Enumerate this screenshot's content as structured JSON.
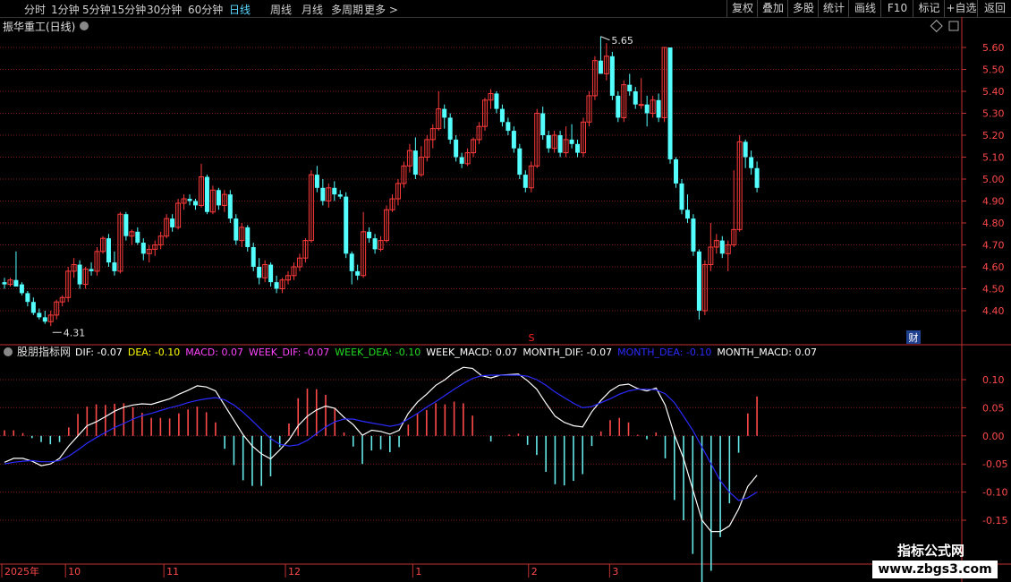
{
  "toolbar": {
    "periods": [
      "分时",
      "1分钟",
      "5分钟",
      "15分钟",
      "30分钟",
      "60分钟",
      "日线",
      "周线",
      "月线",
      "多周期",
      "更多 >"
    ],
    "active_period": "日线",
    "right_buttons": [
      "复权",
      "叠加",
      "多股",
      "统计",
      "画线",
      "F10",
      "标记",
      "+自选",
      "返回"
    ]
  },
  "main_panel": {
    "title": "振华重工(日线)",
    "high_label": "5.65",
    "low_label": "4.31",
    "s_marker": "S",
    "cai_badge": "财"
  },
  "indicator_panel": {
    "name": "股朋指标网",
    "legend": [
      {
        "text": "DIF: -0.07",
        "color": "#ffffff"
      },
      {
        "text": "DEA: -0.10",
        "color": "#ffff00"
      },
      {
        "text": "MACD: 0.07",
        "color": "#ff44ff"
      },
      {
        "text": "WEEK_DIF: -0.07",
        "color": "#ff44ff"
      },
      {
        "text": "WEEK_DEA: -0.10",
        "color": "#22dd22"
      },
      {
        "text": "WEEK_MACD: 0.07",
        "color": "#ffffff"
      },
      {
        "text": "MONTH_DIF: -0.07",
        "color": "#ffffff"
      },
      {
        "text": "MONTH_DEA: -0.10",
        "color": "#2b2bff"
      },
      {
        "text": "MONTH_MACD: 0.07",
        "color": "#ffffff"
      }
    ]
  },
  "x_axis": {
    "labels": [
      {
        "text": "2025年",
        "idx": 0
      },
      {
        "text": "10",
        "idx": 11
      },
      {
        "text": "11",
        "idx": 28
      },
      {
        "text": "12",
        "idx": 49
      },
      {
        "text": "1",
        "idx": 71
      },
      {
        "text": "2",
        "idx": 91
      },
      {
        "text": "3",
        "idx": 105
      }
    ]
  },
  "watermark": {
    "line1": "指标公式网",
    "line2": "www.zbgs3.com"
  },
  "colors": {
    "up": "#ff3b3b",
    "down": "#54ffff",
    "grid": "#7a1a1a",
    "axis": "#c03030",
    "dif": "#ffffff",
    "dea": "#2b2bff"
  },
  "chart_data": [
    {
      "type": "candlestick",
      "title": "振华重工(日线)",
      "ylim": [
        4.31,
        5.65
      ],
      "y_ticks": [
        4.4,
        4.5,
        4.6,
        4.7,
        4.8,
        4.9,
        5.0,
        5.1,
        5.2,
        5.3,
        5.4,
        5.5,
        5.6
      ],
      "ohlc": [
        [
          4.53,
          4.55,
          4.5,
          4.52
        ],
        [
          4.52,
          4.55,
          4.51,
          4.54
        ],
        [
          4.54,
          4.67,
          4.52,
          4.51
        ],
        [
          4.52,
          4.53,
          4.47,
          4.48
        ],
        [
          4.48,
          4.49,
          4.42,
          4.44
        ],
        [
          4.44,
          4.46,
          4.38,
          4.39
        ],
        [
          4.39,
          4.41,
          4.36,
          4.37
        ],
        [
          4.37,
          4.4,
          4.34,
          4.35
        ],
        [
          4.35,
          4.4,
          4.33,
          4.38
        ],
        [
          4.38,
          4.45,
          4.36,
          4.44
        ],
        [
          4.44,
          4.47,
          4.42,
          4.46
        ],
        [
          4.46,
          4.6,
          4.44,
          4.58
        ],
        [
          4.58,
          4.64,
          4.55,
          4.61
        ],
        [
          4.61,
          4.63,
          4.5,
          4.52
        ],
        [
          4.52,
          4.6,
          4.5,
          4.59
        ],
        [
          4.59,
          4.62,
          4.56,
          4.58
        ],
        [
          4.58,
          4.69,
          4.56,
          4.67
        ],
        [
          4.67,
          4.74,
          4.66,
          4.73
        ],
        [
          4.73,
          4.75,
          4.6,
          4.62
        ],
        [
          4.62,
          4.67,
          4.56,
          4.58
        ],
        [
          4.58,
          4.85,
          4.57,
          4.84
        ],
        [
          4.84,
          4.85,
          4.72,
          4.74
        ],
        [
          4.74,
          4.77,
          4.7,
          4.76
        ],
        [
          4.76,
          4.78,
          4.7,
          4.71
        ],
        [
          4.71,
          4.73,
          4.63,
          4.66
        ],
        [
          4.66,
          4.7,
          4.62,
          4.68
        ],
        [
          4.68,
          4.72,
          4.65,
          4.7
        ],
        [
          4.7,
          4.76,
          4.68,
          4.74
        ],
        [
          4.74,
          4.84,
          4.73,
          4.82
        ],
        [
          4.82,
          4.84,
          4.76,
          4.78
        ],
        [
          4.78,
          4.91,
          4.77,
          4.89
        ],
        [
          4.89,
          4.93,
          4.86,
          4.91
        ],
        [
          4.91,
          4.93,
          4.88,
          4.9
        ],
        [
          4.9,
          4.91,
          4.86,
          4.88
        ],
        [
          4.88,
          5.07,
          4.87,
          5.01
        ],
        [
          5.01,
          5.02,
          4.84,
          4.85
        ],
        [
          4.85,
          4.97,
          4.84,
          4.95
        ],
        [
          4.95,
          4.96,
          4.86,
          4.88
        ],
        [
          4.88,
          4.95,
          4.85,
          4.93
        ],
        [
          4.93,
          4.95,
          4.8,
          4.82
        ],
        [
          4.82,
          4.84,
          4.7,
          4.72
        ],
        [
          4.72,
          4.8,
          4.69,
          4.78
        ],
        [
          4.78,
          4.79,
          4.67,
          4.69
        ],
        [
          4.69,
          4.71,
          4.58,
          4.6
        ],
        [
          4.6,
          4.64,
          4.52,
          4.55
        ],
        [
          4.55,
          4.63,
          4.53,
          4.61
        ],
        [
          4.61,
          4.62,
          4.51,
          4.53
        ],
        [
          4.53,
          4.56,
          4.48,
          4.5
        ],
        [
          4.5,
          4.55,
          4.48,
          4.54
        ],
        [
          4.54,
          4.58,
          4.52,
          4.56
        ],
        [
          4.56,
          4.62,
          4.54,
          4.6
        ],
        [
          4.6,
          4.66,
          4.58,
          4.64
        ],
        [
          4.64,
          4.73,
          4.62,
          4.72
        ],
        [
          4.72,
          5.04,
          4.71,
          5.02
        ],
        [
          5.02,
          5.06,
          4.94,
          4.96
        ],
        [
          4.96,
          5.0,
          4.88,
          4.9
        ],
        [
          4.9,
          4.98,
          4.87,
          4.96
        ],
        [
          4.96,
          4.99,
          4.9,
          4.93
        ],
        [
          4.93,
          4.95,
          4.91,
          4.92
        ],
        [
          4.92,
          4.94,
          4.64,
          4.66
        ],
        [
          4.66,
          4.67,
          4.52,
          4.58
        ],
        [
          4.58,
          4.61,
          4.54,
          4.56
        ],
        [
          4.56,
          4.85,
          4.55,
          4.76
        ],
        [
          4.76,
          4.78,
          4.71,
          4.73
        ],
        [
          4.73,
          4.75,
          4.66,
          4.68
        ],
        [
          4.68,
          4.74,
          4.67,
          4.72
        ],
        [
          4.72,
          4.88,
          4.71,
          4.86
        ],
        [
          4.86,
          4.93,
          4.85,
          4.91
        ],
        [
          4.91,
          5.0,
          4.88,
          4.98
        ],
        [
          4.98,
          5.08,
          4.96,
          5.06
        ],
        [
          5.06,
          5.16,
          5.03,
          5.13
        ],
        [
          5.13,
          5.19,
          5.0,
          5.02
        ],
        [
          5.02,
          5.15,
          5.01,
          5.1
        ],
        [
          5.1,
          5.2,
          5.08,
          5.18
        ],
        [
          5.18,
          5.25,
          5.14,
          5.23
        ],
        [
          5.23,
          5.4,
          5.22,
          5.32
        ],
        [
          5.32,
          5.34,
          5.23,
          5.28
        ],
        [
          5.28,
          5.3,
          5.16,
          5.18
        ],
        [
          5.18,
          5.2,
          5.08,
          5.1
        ],
        [
          5.1,
          5.12,
          5.05,
          5.07
        ],
        [
          5.07,
          5.14,
          5.06,
          5.12
        ],
        [
          5.12,
          5.19,
          5.1,
          5.18
        ],
        [
          5.18,
          5.26,
          5.16,
          5.24
        ],
        [
          5.24,
          5.37,
          5.22,
          5.36
        ],
        [
          5.36,
          5.41,
          5.32,
          5.39
        ],
        [
          5.39,
          5.4,
          5.3,
          5.32
        ],
        [
          5.32,
          5.34,
          5.24,
          5.26
        ],
        [
          5.26,
          5.28,
          5.2,
          5.22
        ],
        [
          5.22,
          5.24,
          5.12,
          5.14
        ],
        [
          5.14,
          5.16,
          5.0,
          5.02
        ],
        [
          5.02,
          5.04,
          4.94,
          4.96
        ],
        [
          4.96,
          5.08,
          4.94,
          5.06
        ],
        [
          5.06,
          5.32,
          5.05,
          5.3
        ],
        [
          5.3,
          5.33,
          5.18,
          5.2
        ],
        [
          5.2,
          5.22,
          5.12,
          5.14
        ],
        [
          5.14,
          5.22,
          5.12,
          5.2
        ],
        [
          5.2,
          5.22,
          5.1,
          5.12
        ],
        [
          5.12,
          5.24,
          5.1,
          5.18
        ],
        [
          5.18,
          5.25,
          5.14,
          5.16
        ],
        [
          5.16,
          5.18,
          5.1,
          5.12
        ],
        [
          5.12,
          5.28,
          5.1,
          5.26
        ],
        [
          5.26,
          5.4,
          5.24,
          5.38
        ],
        [
          5.38,
          5.56,
          5.36,
          5.54
        ],
        [
          5.54,
          5.65,
          5.5,
          5.48
        ],
        [
          5.48,
          5.62,
          5.45,
          5.56
        ],
        [
          5.56,
          5.58,
          5.36,
          5.38
        ],
        [
          5.38,
          5.4,
          5.26,
          5.28
        ],
        [
          5.28,
          5.45,
          5.26,
          5.43
        ],
        [
          5.43,
          5.48,
          5.38,
          5.4
        ],
        [
          5.4,
          5.42,
          5.32,
          5.34
        ],
        [
          5.34,
          5.46,
          5.32,
          5.34
        ],
        [
          5.34,
          5.38,
          5.24,
          5.3
        ],
        [
          5.3,
          5.38,
          5.28,
          5.36
        ],
        [
          5.36,
          5.39,
          5.26,
          5.28
        ],
        [
          5.28,
          5.6,
          5.26,
          5.6
        ],
        [
          5.6,
          5.6,
          5.07,
          5.09
        ],
        [
          5.09,
          5.1,
          4.96,
          4.98
        ],
        [
          4.98,
          5.0,
          4.84,
          4.86
        ],
        [
          4.86,
          4.93,
          4.8,
          4.82
        ],
        [
          4.82,
          4.84,
          4.65,
          4.67
        ],
        [
          4.67,
          4.68,
          4.36,
          4.4
        ],
        [
          4.4,
          4.63,
          4.38,
          4.61
        ],
        [
          4.61,
          4.8,
          4.58,
          4.69
        ],
        [
          4.69,
          4.75,
          4.66,
          4.72
        ],
        [
          4.72,
          4.74,
          4.64,
          4.66
        ],
        [
          4.66,
          4.72,
          4.58,
          4.7
        ],
        [
          4.7,
          5.04,
          4.69,
          4.77
        ],
        [
          4.77,
          5.2,
          4.76,
          5.17
        ],
        [
          5.17,
          5.18,
          5.05,
          5.1
        ],
        [
          5.1,
          5.13,
          5.02,
          5.05
        ],
        [
          5.05,
          5.08,
          4.94,
          4.96
        ]
      ]
    },
    {
      "type": "line+bar",
      "title": "股朋指标网",
      "ylim": [
        -0.18,
        0.15
      ],
      "y_ticks": [
        0.1,
        0.05,
        0.0,
        -0.05,
        -0.1,
        -0.15
      ],
      "series": [
        {
          "name": "DIF",
          "values": [
            -0.047,
            -0.04,
            -0.04,
            -0.045,
            -0.053,
            -0.05,
            -0.04,
            -0.018,
            0.0,
            0.018,
            0.025,
            0.034,
            0.044,
            0.051,
            0.055,
            0.057,
            0.056,
            0.061,
            0.066,
            0.074,
            0.081,
            0.089,
            0.087,
            0.08,
            0.054,
            0.028,
            0.002,
            -0.018,
            -0.032,
            -0.041,
            -0.025,
            -0.007,
            0.018,
            0.035,
            0.046,
            0.053,
            0.049,
            0.033,
            0.02,
            0.001,
            0.01,
            0.008,
            0.003,
            0.01,
            0.04,
            0.06,
            0.074,
            0.09,
            0.1,
            0.113,
            0.122,
            0.12,
            0.107,
            0.103,
            0.108,
            0.109,
            0.11,
            0.098,
            0.083,
            0.058,
            0.035,
            0.024,
            0.018,
            0.016,
            0.043,
            0.063,
            0.08,
            0.09,
            0.092,
            0.084,
            0.08,
            0.085,
            0.055,
            0.002,
            -0.04,
            -0.095,
            -0.15,
            -0.17,
            -0.17,
            -0.16,
            -0.13,
            -0.09,
            -0.07
          ]
        },
        {
          "name": "DEA",
          "values": [
            -0.05,
            -0.047,
            -0.045,
            -0.044,
            -0.046,
            -0.046,
            -0.044,
            -0.036,
            -0.025,
            -0.013,
            -0.003,
            0.006,
            0.015,
            0.022,
            0.03,
            0.036,
            0.04,
            0.045,
            0.05,
            0.054,
            0.059,
            0.063,
            0.066,
            0.068,
            0.064,
            0.055,
            0.042,
            0.027,
            0.011,
            -0.005,
            -0.015,
            -0.018,
            -0.016,
            -0.008,
            0.004,
            0.016,
            0.025,
            0.03,
            0.03,
            0.026,
            0.023,
            0.02,
            0.017,
            0.02,
            0.03,
            0.04,
            0.051,
            0.061,
            0.072,
            0.083,
            0.093,
            0.102,
            0.107,
            0.108,
            0.108,
            0.108,
            0.108,
            0.106,
            0.1,
            0.09,
            0.078,
            0.068,
            0.058,
            0.05,
            0.052,
            0.059,
            0.066,
            0.074,
            0.08,
            0.083,
            0.083,
            0.082,
            0.075,
            0.059,
            0.035,
            0.01,
            -0.02,
            -0.05,
            -0.08,
            -0.1,
            -0.115,
            -0.11,
            -0.1
          ]
        },
        {
          "name": "MACD",
          "bars": [
            0.01,
            0.01,
            0.005,
            -0.004,
            -0.011,
            -0.015,
            -0.011,
            0.015,
            0.039,
            0.052,
            0.056,
            0.055,
            0.057,
            0.058,
            0.051,
            0.041,
            0.032,
            0.032,
            0.031,
            0.04,
            0.047,
            0.052,
            0.042,
            0.024,
            -0.023,
            -0.052,
            -0.079,
            -0.089,
            -0.089,
            -0.072,
            -0.02,
            0.022,
            0.067,
            0.084,
            0.083,
            0.073,
            0.048,
            0.006,
            -0.019,
            -0.05,
            -0.026,
            -0.024,
            -0.029,
            -0.02,
            0.02,
            0.04,
            0.046,
            0.058,
            0.056,
            0.061,
            0.058,
            0.036,
            0.0,
            -0.01,
            0.0,
            0.002,
            0.004,
            -0.016,
            -0.034,
            -0.064,
            -0.086,
            -0.088,
            -0.08,
            -0.068,
            -0.018,
            0.008,
            0.028,
            0.032,
            0.024,
            0.002,
            -0.006,
            0.006,
            -0.04,
            -0.114,
            -0.15,
            -0.21,
            -0.26,
            -0.24,
            -0.18,
            -0.12,
            -0.03,
            0.04,
            0.07
          ]
        }
      ]
    }
  ]
}
